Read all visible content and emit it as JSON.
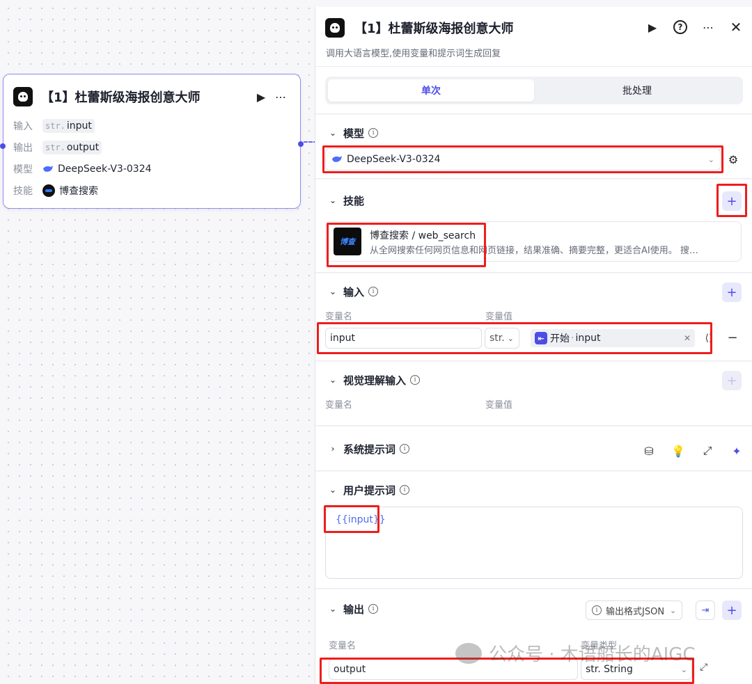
{
  "node": {
    "title": "【1】杜蕾斯级海报创意大师",
    "rows": [
      {
        "label": "输入",
        "prefix": "str.",
        "value": "input"
      },
      {
        "label": "输出",
        "prefix": "str.",
        "value": "output"
      },
      {
        "label": "模型",
        "value": "DeepSeek-V3-0324"
      },
      {
        "label": "技能",
        "value": "博查搜索"
      }
    ]
  },
  "panel": {
    "title": "【1】杜蕾斯级海报创意大师",
    "description": "调用大语言模型,使用变量和提示词生成回复",
    "tabs": [
      {
        "label": "单次",
        "active": true
      },
      {
        "label": "批处理",
        "active": false
      }
    ],
    "model": {
      "heading": "模型",
      "selected": "DeepSeek-V3-0324"
    },
    "skills": {
      "heading": "技能",
      "items": [
        {
          "logo_text": "博查",
          "name": "博查搜索 / web_search",
          "description": "从全网搜索任何网页信息和网页链接，结果准确、摘要完整，更适合AI使用。 搜…"
        }
      ]
    },
    "inputs": {
      "heading": "输入",
      "col_name": "变量名",
      "col_value": "变量值",
      "rows": [
        {
          "name": "input",
          "type": "str.",
          "ref_source": "开始",
          "ref_var": "input"
        }
      ]
    },
    "vision_inputs": {
      "heading": "视觉理解输入",
      "col_name": "变量名",
      "col_value": "变量值"
    },
    "system_prompt": {
      "heading": "系统提示词"
    },
    "user_prompt": {
      "heading": "用户提示词",
      "content": "{{input}}"
    },
    "outputs": {
      "heading": "输出",
      "format_label": "输出格式JSON",
      "col_name": "变量名",
      "col_type": "变量类型",
      "rows": [
        {
          "name": "output",
          "type": "str. String"
        }
      ]
    }
  },
  "watermark": {
    "text": "公众号 · 木语船长的AIGC"
  },
  "colors": {
    "accent": "#4e4de6",
    "highlight_box": "#ee1d1d"
  }
}
